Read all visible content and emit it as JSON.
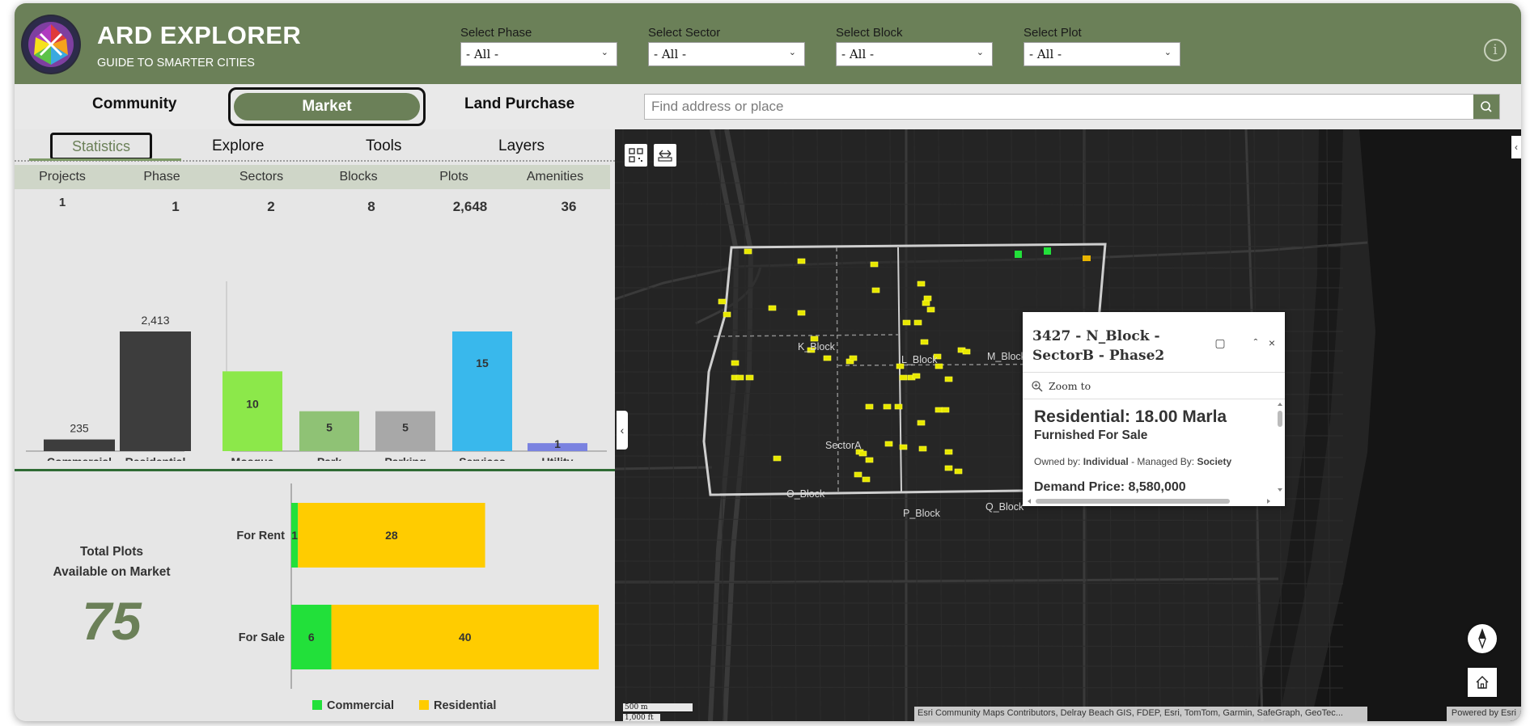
{
  "header": {
    "title": "ARD EXPLORER",
    "subtitle": "GUIDE TO SMARTER CITIES",
    "filters": [
      {
        "label": "Select Phase",
        "value": "- All -"
      },
      {
        "label": "Select Sector",
        "value": "- All -"
      },
      {
        "label": "Select Block",
        "value": "- All -"
      },
      {
        "label": "Select Plot",
        "value": "- All -"
      }
    ],
    "info_icon": "info-icon"
  },
  "nav": {
    "tabs": [
      "Community",
      "Market",
      "Land Purchase"
    ],
    "active": "Market",
    "search_placeholder": "Find address or place"
  },
  "left": {
    "subtabs": [
      "Statistics",
      "Explore",
      "Tools",
      "Layers"
    ],
    "active_subtab": "Statistics",
    "stats": [
      {
        "label": "Projects",
        "value": "1"
      },
      {
        "label": "Phase",
        "value": "1"
      },
      {
        "label": "Sectors",
        "value": "2"
      },
      {
        "label": "Blocks",
        "value": "8"
      },
      {
        "label": "Plots",
        "value": "2,648"
      },
      {
        "label": "Amenities",
        "value": "36"
      }
    ],
    "total_label_line1": "Total Plots",
    "total_label_line2": "Available on Market",
    "total_value": "75"
  },
  "chart_data": [
    {
      "type": "bar",
      "title": "",
      "categories": [
        "Commercial",
        "Residential"
      ],
      "values": [
        235,
        2413
      ],
      "value_labels": [
        "235",
        "2,413"
      ],
      "ylim": [
        0,
        2413
      ],
      "colors": [
        "#3d3d3d",
        "#3d3d3d"
      ]
    },
    {
      "type": "bar",
      "title": "",
      "categories": [
        "Mosque",
        "Park",
        "Parking",
        "Services",
        "Utility"
      ],
      "values": [
        10,
        5,
        5,
        15,
        1
      ],
      "ylim": [
        0,
        15
      ],
      "colors": [
        "#8ce84a",
        "#8fc275",
        "#a8a8a8",
        "#39b8ec",
        "#7a82e0"
      ]
    },
    {
      "type": "bar",
      "orientation": "horizontal",
      "stacked": true,
      "categories": [
        "For Rent",
        "For Sale"
      ],
      "series": [
        {
          "name": "Commercial",
          "values": [
            1,
            6
          ],
          "color": "#22e03a"
        },
        {
          "name": "Residential",
          "values": [
            28,
            40
          ],
          "color": "#ffcc00"
        }
      ],
      "xlim": [
        0,
        46
      ],
      "legend_position": "bottom"
    }
  ],
  "map": {
    "block_labels": [
      "K_Block",
      "L_Block",
      "M_Block",
      "SectorA",
      "O_Block",
      "P_Block",
      "Q_Block"
    ],
    "popup": {
      "title": "3427 - N_Block - SectorB - Phase2",
      "zoom_label": "Zoom to",
      "heading": "Residential: 18.00 Marla",
      "subheading": "Furnished For Sale",
      "owned_by_label": "Owned by:",
      "owned_by_value": "Individual",
      "managed_by_label": "- Managed By:",
      "managed_by_value": "Society",
      "price_label": "Demand Price:",
      "price_value": "8,580,000"
    },
    "scale_m": "500 m",
    "scale_ft": "1,000 ft",
    "attribution": "Esri Community Maps Contributors, Delray Beach GIS, FDEP, Esri, TomTom, Garmin, SafeGraph, GeoTec...",
    "powered_by": "Powered by Esri"
  }
}
